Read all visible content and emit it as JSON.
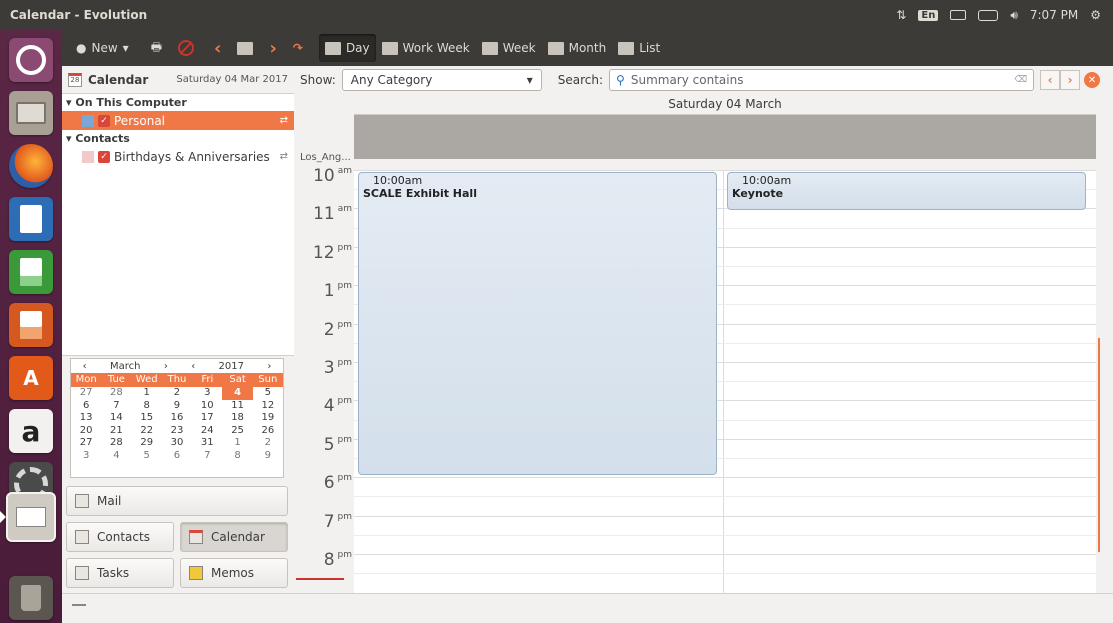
{
  "window": {
    "title": "Calendar - Evolution"
  },
  "tray": {
    "lang": "En",
    "time": "7:07 PM"
  },
  "launcher": [
    "dash-icon",
    "files-icon",
    "firefox-icon",
    "writer-icon",
    "calc-icon",
    "impress-icon",
    "software-center-icon",
    "amazon-icon",
    "system-settings-icon",
    "evolution-mail-icon",
    "trash-icon"
  ],
  "toolbar": {
    "new_label": "New",
    "views": {
      "day": "Day",
      "work_week": "Work Week",
      "week": "Week",
      "month": "Month",
      "list": "List"
    },
    "active_view": "Day"
  },
  "left": {
    "header_title": "Calendar",
    "header_date": "Saturday 04 Mar 2017",
    "groups": [
      {
        "name": "On This Computer",
        "items": [
          {
            "label": "Personal",
            "color": "#7aa7d6",
            "checked": true,
            "selected": true
          }
        ]
      },
      {
        "name": "Contacts",
        "items": [
          {
            "label": "Birthdays & Anniversaries",
            "color": "#f3c9c9",
            "checked": true,
            "selected": false
          }
        ]
      }
    ],
    "minical": {
      "month": "March",
      "year": "2017",
      "day_headers": [
        "Mon",
        "Tue",
        "Wed",
        "Thu",
        "Fri",
        "Sat",
        "Sun"
      ],
      "weeks": [
        [
          "27",
          "28",
          "1",
          "2",
          "3",
          "4",
          "5"
        ],
        [
          "6",
          "7",
          "8",
          "9",
          "10",
          "11",
          "12"
        ],
        [
          "13",
          "14",
          "15",
          "16",
          "17",
          "18",
          "19"
        ],
        [
          "20",
          "21",
          "22",
          "23",
          "24",
          "25",
          "26"
        ],
        [
          "27",
          "28",
          "29",
          "30",
          "31",
          "1",
          "2"
        ],
        [
          "3",
          "4",
          "5",
          "6",
          "7",
          "8",
          "9"
        ]
      ],
      "today": "4"
    },
    "switcher": {
      "mail": "Mail",
      "contacts": "Contacts",
      "calendar": "Calendar",
      "tasks": "Tasks",
      "memos": "Memos",
      "active": "Calendar"
    }
  },
  "filter": {
    "show_label": "Show:",
    "category": "Any Category",
    "search_label": "Search:",
    "search_placeholder": "Summary contains"
  },
  "dayview": {
    "date_title": "Saturday 04 March",
    "timezone": "Los_Ang...",
    "hours": [
      {
        "h": "10",
        "ap": "am"
      },
      {
        "h": "11",
        "ap": "am"
      },
      {
        "h": "12",
        "ap": "pm"
      },
      {
        "h": "1",
        "ap": "pm"
      },
      {
        "h": "2",
        "ap": "pm"
      },
      {
        "h": "3",
        "ap": "pm"
      },
      {
        "h": "4",
        "ap": "pm"
      },
      {
        "h": "5",
        "ap": "pm"
      },
      {
        "h": "6",
        "ap": "pm"
      },
      {
        "h": "7",
        "ap": "pm"
      },
      {
        "h": "8",
        "ap": "pm"
      }
    ],
    "events": [
      {
        "time": "10:00am",
        "name": "SCALE Exhibit Hall"
      },
      {
        "time": "10:00am",
        "name": "Keynote"
      }
    ]
  }
}
